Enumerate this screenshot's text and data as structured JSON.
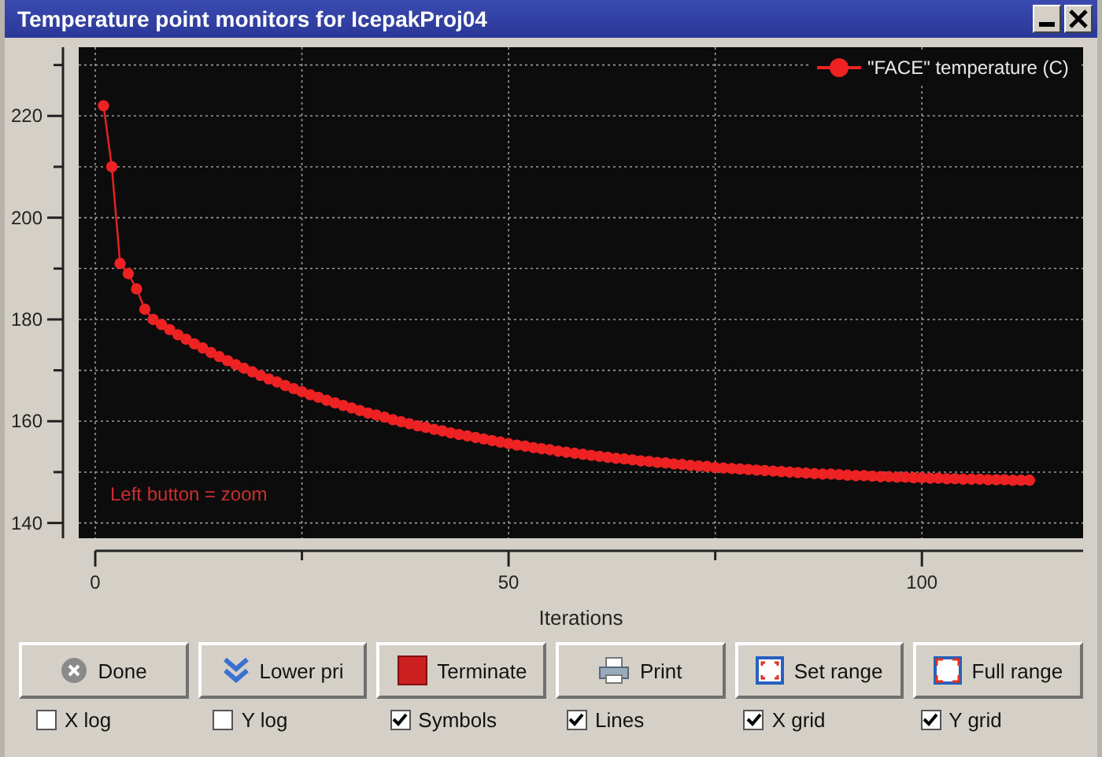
{
  "window": {
    "title": "Temperature point monitors for IcepakProj04"
  },
  "plot": {
    "hint": "Left button = zoom",
    "chart_data": {
      "type": "line",
      "grid": true,
      "xlabel": "Iterations",
      "xlim": [
        -2,
        119.5
      ],
      "ylim": [
        137,
        233.5
      ],
      "xticks": [
        0,
        50,
        100
      ],
      "yticks": [
        140,
        160,
        180,
        200,
        220
      ],
      "x": [
        1,
        2,
        3,
        4,
        5,
        6,
        7,
        8,
        9,
        10,
        11,
        12,
        13,
        14,
        15,
        16,
        17,
        18,
        19,
        20,
        21,
        22,
        23,
        24,
        25,
        26,
        27,
        28,
        29,
        30,
        31,
        32,
        33,
        34,
        35,
        36,
        37,
        38,
        39,
        40,
        41,
        42,
        43,
        44,
        45,
        46,
        47,
        48,
        49,
        50,
        51,
        52,
        53,
        54,
        55,
        56,
        57,
        58,
        59,
        60,
        61,
        62,
        63,
        64,
        65,
        66,
        67,
        68,
        69,
        70,
        71,
        72,
        73,
        74,
        75,
        76,
        77,
        78,
        79,
        80,
        81,
        82,
        83,
        84,
        85,
        86,
        87,
        88,
        89,
        90,
        91,
        92,
        93,
        94,
        95,
        96,
        97,
        98,
        99,
        100,
        101,
        102,
        103,
        104,
        105,
        106,
        107,
        108,
        109,
        110,
        111,
        112,
        113
      ],
      "series": [
        {
          "name": "\"FACE\" temperature (C)",
          "color": "#ee2222",
          "marker": "circle",
          "values": [
            222,
            210,
            191,
            189,
            186,
            182,
            180,
            179,
            178,
            177,
            176.1,
            175.2,
            174.4,
            173.5,
            172.7,
            171.9,
            171.1,
            170.4,
            169.7,
            169,
            168.3,
            167.7,
            167,
            166.4,
            165.8,
            165.2,
            164.7,
            164.1,
            163.6,
            163.1,
            162.6,
            162.1,
            161.6,
            161.2,
            160.8,
            160.3,
            159.9,
            159.5,
            159.1,
            158.8,
            158.4,
            158.1,
            157.7,
            157.4,
            157.1,
            156.8,
            156.5,
            156.2,
            155.9,
            155.6,
            155.3,
            155.1,
            154.8,
            154.6,
            154.4,
            154.1,
            153.9,
            153.7,
            153.5,
            153.3,
            153.1,
            152.9,
            152.7,
            152.6,
            152.4,
            152.2,
            152.1,
            151.9,
            151.8,
            151.6,
            151.5,
            151.3,
            151.2,
            151.1,
            150.9,
            150.8,
            150.7,
            150.6,
            150.5,
            150.4,
            150.3,
            150.2,
            150.1,
            150,
            149.9,
            149.8,
            149.7,
            149.6,
            149.6,
            149.5,
            149.4,
            149.3,
            149.3,
            149.2,
            149.1,
            149.1,
            149,
            149,
            148.9,
            148.9,
            148.8,
            148.8,
            148.7,
            148.7,
            148.6,
            148.6,
            148.6,
            148.5,
            148.5,
            148.5,
            148.4,
            148.4,
            148.4
          ]
        }
      ]
    }
  },
  "buttons": [
    {
      "label": "Done"
    },
    {
      "label": "Lower pri"
    },
    {
      "label": "Terminate"
    },
    {
      "label": "Print"
    },
    {
      "label": "Set range"
    },
    {
      "label": "Full range"
    }
  ],
  "options": [
    {
      "label": "X log",
      "checked": false
    },
    {
      "label": "Y log",
      "checked": false
    },
    {
      "label": "Symbols",
      "checked": true
    },
    {
      "label": "Lines",
      "checked": true
    },
    {
      "label": "X grid",
      "checked": true
    },
    {
      "label": "Y grid",
      "checked": true
    }
  ]
}
